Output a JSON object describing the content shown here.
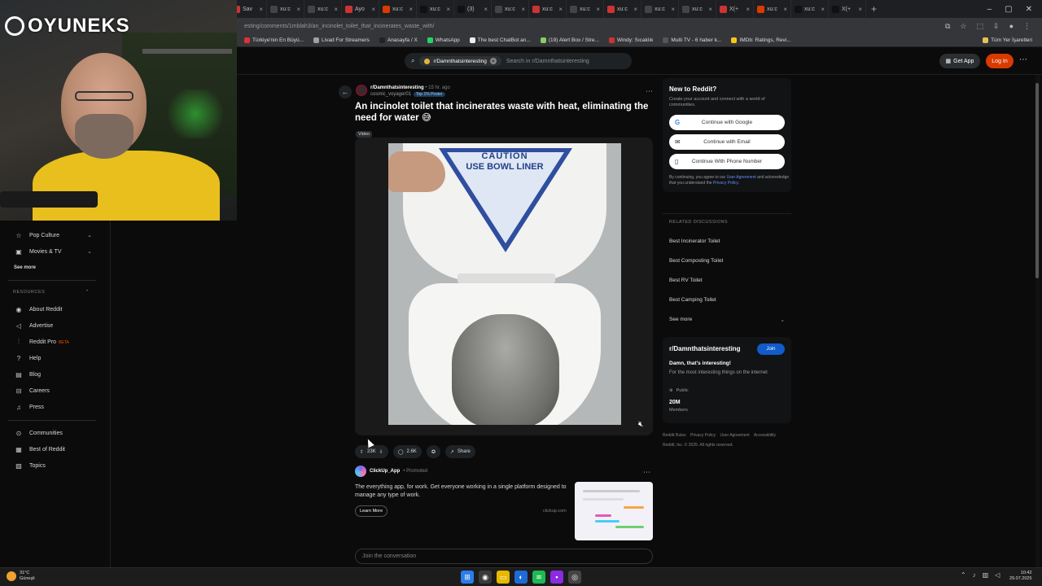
{
  "browser": {
    "tabs": [
      {
        "label": "An",
        "active": true
      },
      {
        "label": "X(+"
      },
      {
        "label": "X(+"
      },
      {
        "label": "xu:c"
      },
      {
        "label": "Erd"
      },
      {
        "label": "xu:c"
      },
      {
        "label": "Sav"
      },
      {
        "label": "xu:c"
      },
      {
        "label": "xu:c"
      },
      {
        "label": "Ayo"
      },
      {
        "label": "xu:c"
      },
      {
        "label": "xu:c"
      },
      {
        "label": "(3)"
      },
      {
        "label": "xu:c"
      },
      {
        "label": "xu:c"
      },
      {
        "label": "xu:c"
      },
      {
        "label": "xu:c"
      },
      {
        "label": "xu:c"
      },
      {
        "label": "xu:c"
      },
      {
        "label": "X(+"
      },
      {
        "label": "xu:c"
      },
      {
        "label": "xu:c"
      },
      {
        "label": "X(+"
      }
    ],
    "url": "esting/comments/1mblah3/an_incinolet_toilet_that_incinerates_waste_with/",
    "bookmarks": [
      {
        "label": "Türkiye'nin En Büyü...",
        "color": "#d33"
      },
      {
        "label": "Livad For Streamers",
        "color": "#a0a0a0"
      },
      {
        "label": "Anasayfa / X",
        "color": "#222"
      },
      {
        "label": "WhatsApp",
        "color": "#25d366"
      },
      {
        "label": "The best ChatBot an...",
        "color": "#eee"
      },
      {
        "label": "(19) Alert Box / Stre...",
        "color": "#8c6"
      },
      {
        "label": "Windy: Sıcaklık",
        "color": "#c33"
      },
      {
        "label": "Multi TV - 6 haber k...",
        "color": "#555"
      },
      {
        "label": "IMDb: Ratings, Revi...",
        "color": "#f5c518"
      }
    ],
    "all_bookmarks": "Tüm Yer İşaretleri"
  },
  "overlay": {
    "logo_text": "OYUNEKS"
  },
  "header": {
    "search_chip": "r/Damnthatsinteresting",
    "search_placeholder": "Search in r/Damnthatsinteresting",
    "get_app": "Get App",
    "login": "Log In"
  },
  "sidebar": {
    "items": [
      {
        "label": "Pop Culture",
        "icon": "star-icon"
      },
      {
        "label": "Movies & TV",
        "icon": "film-icon"
      }
    ],
    "see_more": "See more",
    "resources_heading": "RESOURCES",
    "resources": [
      {
        "label": "About Reddit",
        "icon": "reddit-icon"
      },
      {
        "label": "Advertise",
        "icon": "megaphone-icon"
      },
      {
        "label": "Reddit Pro",
        "icon": "chart-icon",
        "badge": "BETA"
      },
      {
        "label": "Help",
        "icon": "help-icon"
      },
      {
        "label": "Blog",
        "icon": "book-icon"
      },
      {
        "label": "Careers",
        "icon": "briefcase-icon"
      },
      {
        "label": "Press",
        "icon": "mic-icon"
      }
    ],
    "bottom": [
      {
        "label": "Communities",
        "icon": "communities-icon"
      },
      {
        "label": "Best of Reddit",
        "icon": "best-icon"
      },
      {
        "label": "Topics",
        "icon": "topics-icon"
      }
    ]
  },
  "post": {
    "subreddit": "r/Damnthatsinteresting",
    "time_ago": "15 hr. ago",
    "author": "cosmic_voyager01",
    "author_badge": "Top 1% Poster",
    "title": "An incinolet toilet that incinerates waste with heat, eliminating the need for water",
    "title_emoji": "😅",
    "flair": "Video",
    "video_sign_line1": "CAUTION",
    "video_sign_line2": "USE BOWL LINER",
    "upvotes": "23K",
    "comments": "2.6K",
    "share": "Share"
  },
  "promo": {
    "name": "ClickUp_App",
    "tag": "Promoted",
    "text": "The everything app, for work. Get everyone working in a single platform designed to manage any type of work.",
    "cta": "Learn More",
    "domain": "clickup.com"
  },
  "comment_box": {
    "placeholder": "Join the conversation"
  },
  "signup_card": {
    "title": "New to Reddit?",
    "desc": "Create your account and connect with a world of communities.",
    "google": "Continue with Google",
    "email": "Continue with Email",
    "phone": "Continue With Phone Number",
    "terms_pre": "By continuing, you agree to our",
    "terms_ua": "User Agreement",
    "terms_mid": "and acknowledge that you understand the",
    "terms_pp": "Privacy Policy",
    "terms_end": "."
  },
  "related": {
    "heading": "RELATED DISCUSSIONS",
    "items": [
      "Best Incinerator Toilet",
      "Best Composting Toilet",
      "Best RV Toilet",
      "Best Camping Toilet"
    ],
    "see_more": "See more"
  },
  "subreddit_card": {
    "name": "r/Damnthatsinteresting",
    "join": "Join",
    "tagline": "Damn, that's interesting!",
    "about": "For the most interesting things on the internet",
    "visibility": "Public",
    "members": "20M",
    "members_label": "Members"
  },
  "footer": {
    "links": [
      "Reddit Rules",
      "Privacy Policy",
      "User Agreement",
      "Accessibility"
    ],
    "copyright": "Reddit, Inc. © 2025. All rights reserved."
  },
  "taskbar": {
    "temp": "31°C",
    "weather": "Güneşli",
    "time": "10:42",
    "date": "29.07.2025"
  }
}
